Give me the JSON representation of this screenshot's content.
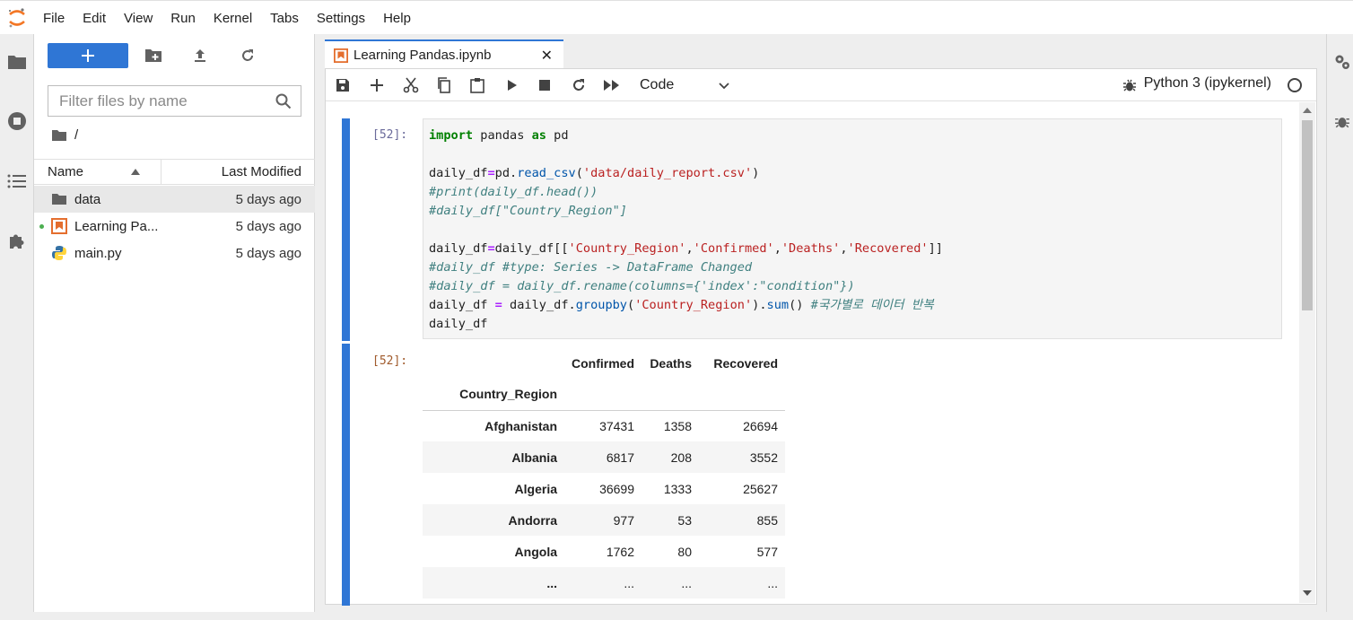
{
  "menu": [
    "File",
    "Edit",
    "View",
    "Run",
    "Kernel",
    "Tabs",
    "Settings",
    "Help"
  ],
  "filebrowser": {
    "filter_placeholder": "Filter files by name",
    "breadcrumb": "/",
    "col_name": "Name",
    "col_modified": "Last Modified",
    "files": [
      {
        "name": "data",
        "modified": "5 days ago",
        "icon": "folder-icon"
      },
      {
        "name": "Learning Pa...",
        "modified": "5 days ago",
        "icon": "notebook-icon"
      },
      {
        "name": "main.py",
        "modified": "5 days ago",
        "icon": "python-icon"
      }
    ]
  },
  "tab": {
    "title": "Learning Pandas.ipynb",
    "close": "✕"
  },
  "toolbar": {
    "cell_type": "Code",
    "kernel": "Python 3 (ipykernel)"
  },
  "cell": {
    "in_prompt": "[52]:",
    "out_prompt": "[52]:",
    "lines": {
      "l1a": "import",
      "l1b": " pandas ",
      "l1c": "as",
      "l1d": " pd",
      "l3a": "daily_df",
      "l3b": "=",
      "l3c": "pd.",
      "l3d": "read_csv",
      "l3e": "(",
      "l3f": "'data/daily_report.csv'",
      "l3g": ")",
      "l4": "#print(daily_df.head())",
      "l5": "#daily_df[\"Country_Region\"]",
      "l7a": "daily_df",
      "l7b": "=",
      "l7c": "daily_df[[",
      "l7d": "'Country_Region'",
      "l7e": ",",
      "l7f": "'Confirmed'",
      "l7g": ",",
      "l7h": "'Deaths'",
      "l7i": ",",
      "l7j": "'Recovered'",
      "l7k": "]]",
      "l8": "#daily_df #type: Series -> DataFrame Changed",
      "l9": "#daily_df = daily_df.rename(columns={'index':\"condition\"})",
      "l10a": "daily_df ",
      "l10b": "=",
      "l10c": " daily_df.",
      "l10d": "groupby",
      "l10e": "(",
      "l10f": "'Country_Region'",
      "l10g": ").",
      "l10h": "sum",
      "l10i": "() ",
      "l10j": "#국가별로 데이터 반복",
      "l11": "daily_df"
    }
  },
  "output": {
    "columns": [
      "Confirmed",
      "Deaths",
      "Recovered"
    ],
    "index_name": "Country_Region",
    "rows": [
      {
        "country": "Afghanistan",
        "confirmed": "37431",
        "deaths": "1358",
        "recovered": "26694"
      },
      {
        "country": "Albania",
        "confirmed": "6817",
        "deaths": "208",
        "recovered": "3552"
      },
      {
        "country": "Algeria",
        "confirmed": "36699",
        "deaths": "1333",
        "recovered": "25627"
      },
      {
        "country": "Andorra",
        "confirmed": "977",
        "deaths": "53",
        "recovered": "855"
      },
      {
        "country": "Angola",
        "confirmed": "1762",
        "deaths": "80",
        "recovered": "577"
      },
      {
        "country": "...",
        "confirmed": "...",
        "deaths": "...",
        "recovered": "..."
      }
    ]
  },
  "colors": {
    "accent": "#2f76d5",
    "notebook_icon": "#e46e2e",
    "python_blue": "#3572a5",
    "python_yellow": "#ffd43b"
  }
}
